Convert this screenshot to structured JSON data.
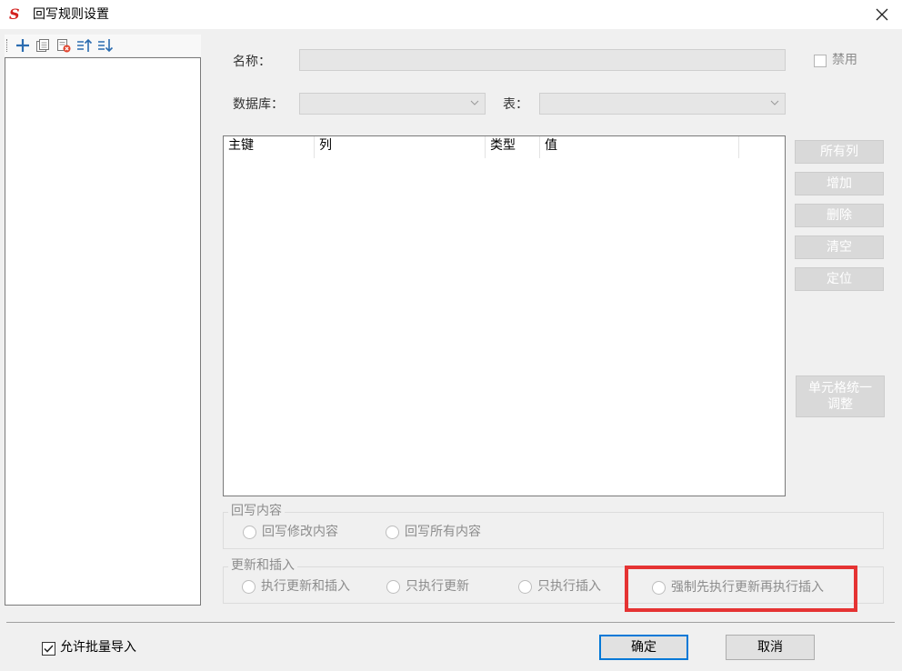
{
  "window": {
    "title": "回写规则设置",
    "app_icon_glyph": "S",
    "close_glyph": "✕"
  },
  "toolbar": {
    "icons": [
      "add-icon",
      "copy-icon",
      "delete-icon",
      "move-up-icon",
      "move-down-icon"
    ]
  },
  "form": {
    "name_label": "名称：",
    "name_value": "",
    "disable_label": "禁用",
    "disable_checked": false,
    "database_label": "数据库：",
    "database_value": "",
    "table_label": "表：",
    "table_value": ""
  },
  "columns_table": {
    "headers": [
      "主键",
      "列",
      "类型",
      "值"
    ],
    "rows": []
  },
  "side_buttons": {
    "all_columns": "所有列",
    "add": "增加",
    "delete": "删除",
    "clear": "清空",
    "locate": "定位",
    "unify_line1": "单元格统一",
    "unify_line2": "调整"
  },
  "writeback_content": {
    "title": "回写内容",
    "options": [
      "回写修改内容",
      "回写所有内容"
    ]
  },
  "update_insert": {
    "title": "更新和插入",
    "options": [
      "执行更新和插入",
      "只执行更新",
      "只执行插入",
      "强制先执行更新再执行插入"
    ]
  },
  "footer": {
    "batch_import_label": "允许批量导入",
    "batch_import_checked": true,
    "ok_label": "确定",
    "cancel_label": "取消"
  },
  "colors": {
    "highlight": "#e53333",
    "disabled_button": "#d9d9d9",
    "focus_border": "#0078d7",
    "app_icon": "#d4211f"
  }
}
